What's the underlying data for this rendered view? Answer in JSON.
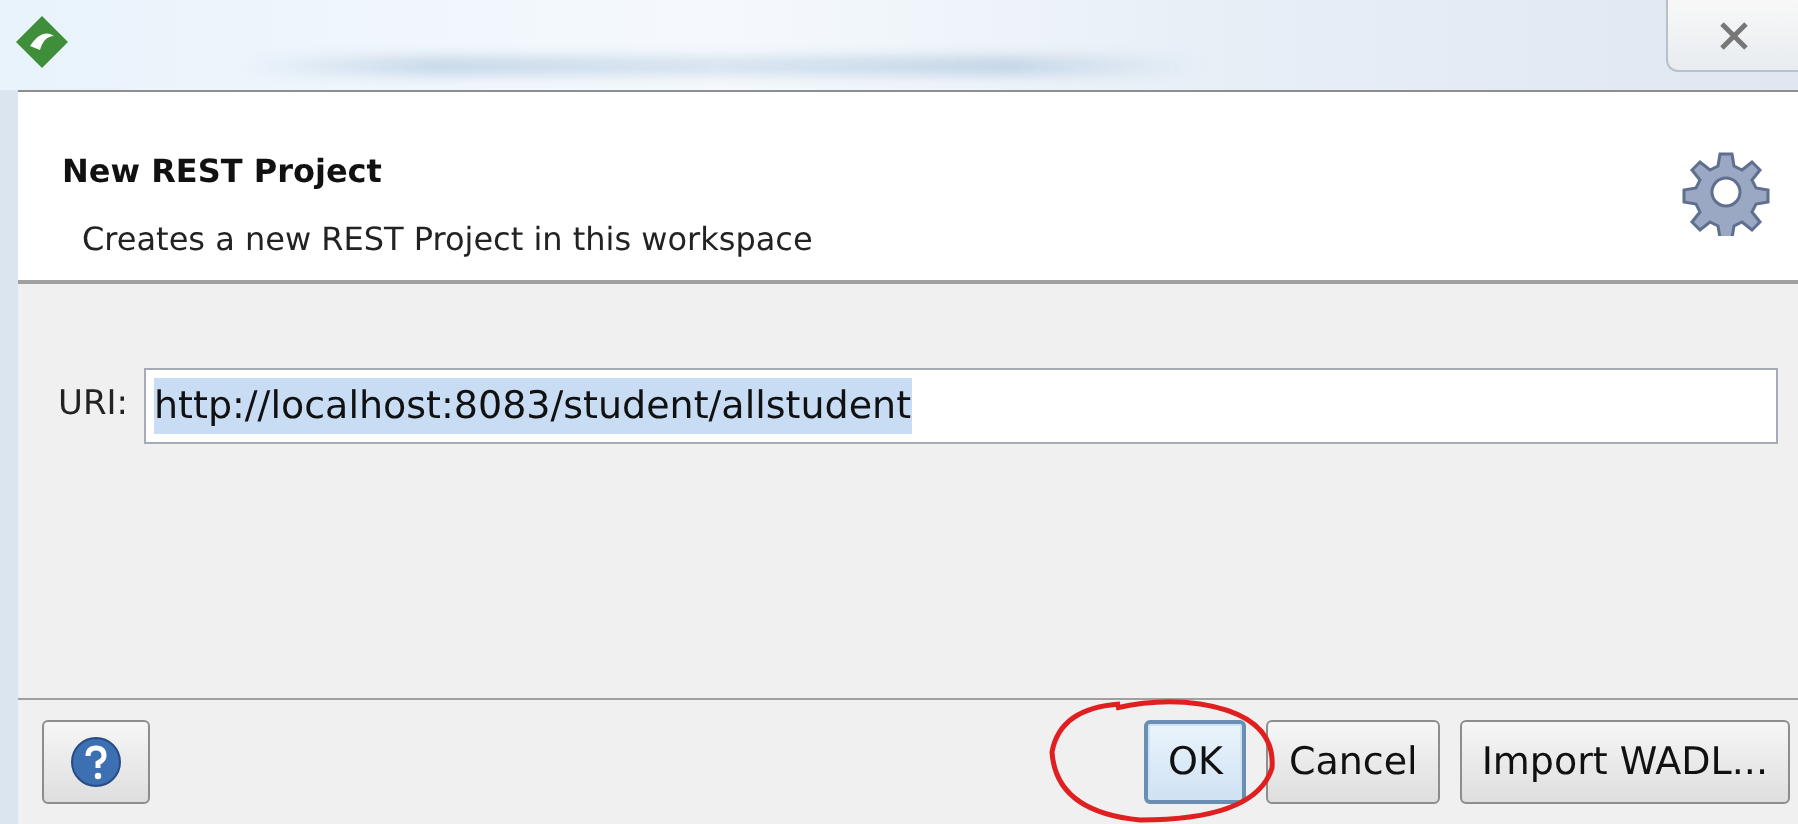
{
  "header": {
    "title": "New REST Project",
    "description": "Creates a new REST Project in this workspace"
  },
  "uri_field": {
    "label": "URI:",
    "value": "http://localhost:8083/student/allstudent",
    "text_selected": true
  },
  "buttons": [
    {
      "kind": "help",
      "default": false,
      "circled": false
    },
    {
      "kind": "text",
      "label": "OK",
      "default": true,
      "circled": true
    },
    {
      "kind": "text",
      "label": "Cancel",
      "default": false,
      "circled": false
    },
    {
      "kind": "text",
      "label": "Import WADL...",
      "default": false,
      "circled": false
    }
  ]
}
